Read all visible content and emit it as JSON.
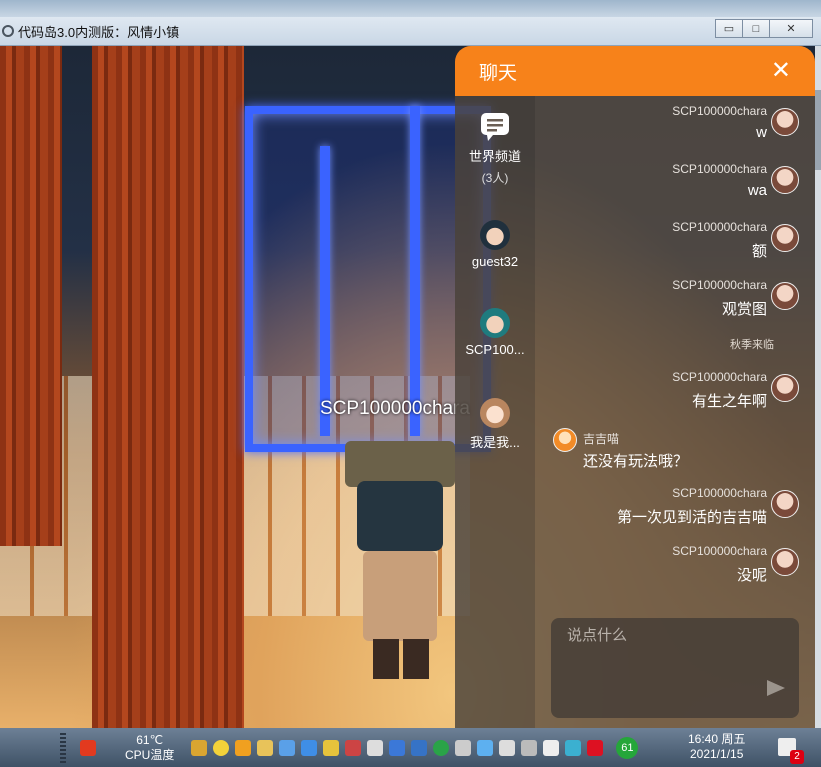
{
  "window": {
    "title": "代码岛3.0内测版：风情小镇",
    "buttons": {
      "minimize_icon": "minimize-icon",
      "maximize_icon": "maximize-icon",
      "close_icon": "close-icon"
    }
  },
  "scene": {
    "player_name": "SCP100000chara"
  },
  "chat": {
    "title": "聊天",
    "close_icon": "close-icon",
    "accent": "#f7821a",
    "channels": [
      {
        "name": "世界频道",
        "count": "(3人)",
        "icon": "chat-icon"
      },
      {
        "name": "guest32",
        "icon": "avatar"
      },
      {
        "name": "SCP100...",
        "icon": "avatar"
      },
      {
        "name": "我是我...",
        "icon": "avatar"
      }
    ],
    "messages": [
      {
        "sender": "SCP100000chara",
        "text": "w",
        "side": "right"
      },
      {
        "sender": "SCP100000chara",
        "text": "wa",
        "side": "right"
      },
      {
        "sender": "SCP100000chara",
        "text": "额",
        "side": "right"
      },
      {
        "sender": "SCP100000chara",
        "text": "观赏图",
        "side": "right"
      },
      {
        "system": "秋季来临"
      },
      {
        "sender": "SCP100000chara",
        "text": "有生之年啊",
        "side": "right"
      },
      {
        "sender": "吉吉喵",
        "text": "还没有玩法哦？",
        "side": "left"
      },
      {
        "sender": "SCP100000chara",
        "text": "第一次见到活的吉吉喵",
        "side": "right"
      },
      {
        "sender": "SCP100000chara",
        "text": "没呢",
        "side": "right"
      }
    ],
    "input": {
      "placeholder": "说点什么",
      "value": ""
    },
    "send_icon": "send-icon"
  },
  "taskbar": {
    "cpu_temp": "61℃",
    "cpu_label": "CPU温度",
    "badge": "61",
    "time": "16:40 周五",
    "date": "2021/1/15",
    "notifications": "2"
  }
}
